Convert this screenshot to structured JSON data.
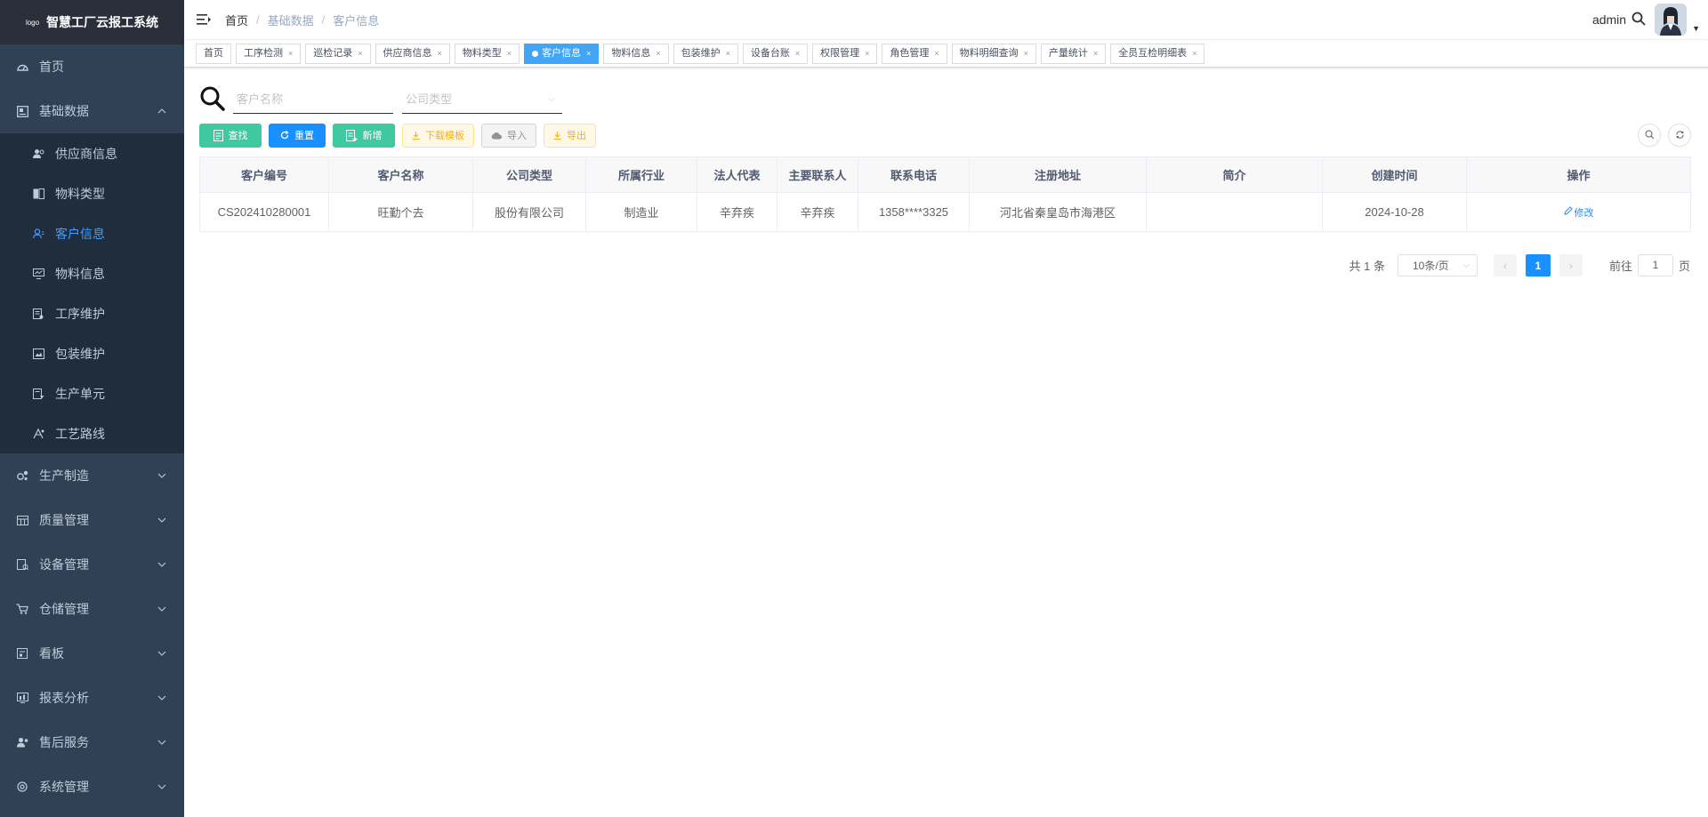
{
  "sidebar": {
    "logo_small": "logo",
    "title": "智慧工厂云报工系统",
    "items": [
      {
        "label": "首页",
        "icon": "dashboard-icon"
      },
      {
        "label": "基础数据",
        "icon": "database-icon",
        "expanded": true,
        "children": [
          {
            "label": "供应商信息",
            "icon": "supplier-icon"
          },
          {
            "label": "物料类型",
            "icon": "material-type-icon"
          },
          {
            "label": "客户信息",
            "icon": "customer-icon",
            "active": true
          },
          {
            "label": "物料信息",
            "icon": "material-icon"
          },
          {
            "label": "工序维护",
            "icon": "process-icon"
          },
          {
            "label": "包装维护",
            "icon": "package-icon"
          },
          {
            "label": "生产单元",
            "icon": "unit-icon"
          },
          {
            "label": "工艺路线",
            "icon": "route-icon"
          }
        ]
      },
      {
        "label": "生产制造",
        "icon": "production-icon"
      },
      {
        "label": "质量管理",
        "icon": "quality-icon"
      },
      {
        "label": "设备管理",
        "icon": "equipment-icon"
      },
      {
        "label": "仓储管理",
        "icon": "warehouse-icon"
      },
      {
        "label": "看板",
        "icon": "board-icon"
      },
      {
        "label": "报表分析",
        "icon": "report-icon"
      },
      {
        "label": "售后服务",
        "icon": "service-icon"
      },
      {
        "label": "系统管理",
        "icon": "system-icon"
      }
    ]
  },
  "navbar": {
    "breadcrumb": [
      "首页",
      "基础数据",
      "客户信息"
    ],
    "user": "admin"
  },
  "tags": [
    {
      "label": "首页",
      "closable": false
    },
    {
      "label": "工序检测",
      "closable": true
    },
    {
      "label": "巡检记录",
      "closable": true
    },
    {
      "label": "供应商信息",
      "closable": true
    },
    {
      "label": "物料类型",
      "closable": true
    },
    {
      "label": "客户信息",
      "closable": true,
      "active": true
    },
    {
      "label": "物料信息",
      "closable": true
    },
    {
      "label": "包装维护",
      "closable": true
    },
    {
      "label": "设备台账",
      "closable": true
    },
    {
      "label": "权限管理",
      "closable": true
    },
    {
      "label": "角色管理",
      "closable": true
    },
    {
      "label": "物料明细查询",
      "closable": true
    },
    {
      "label": "产量统计",
      "closable": true
    },
    {
      "label": "全员互检明细表",
      "closable": true
    }
  ],
  "search": {
    "name_placeholder": "客户名称",
    "type_placeholder": "公司类型"
  },
  "toolbar": {
    "find": "查找",
    "reset": "重置",
    "add": "新增",
    "download_template": "下载模板",
    "import": "导入",
    "export": "导出"
  },
  "table": {
    "columns": [
      "客户编号",
      "客户名称",
      "公司类型",
      "所属行业",
      "法人代表",
      "主要联系人",
      "联系电话",
      "注册地址",
      "简介",
      "创建时间",
      "操作"
    ],
    "rows": [
      [
        "CS202410280001",
        "旺勤个去",
        "股份有限公司",
        "制造业",
        "辛弃疾",
        "辛弃疾",
        "1358****3325",
        "河北省秦皇岛市海港区",
        "",
        "2024-10-28",
        "修改"
      ]
    ]
  },
  "pagination": {
    "total": "共 1 条",
    "page_size": "10条/页",
    "current": "1",
    "goto_prefix": "前往",
    "goto_value": "1",
    "goto_suffix": "页"
  },
  "colors": {
    "sidebar_bg": "#304156",
    "accent": "#1890ff",
    "green": "#40c9a0",
    "warning": "#faad14"
  }
}
